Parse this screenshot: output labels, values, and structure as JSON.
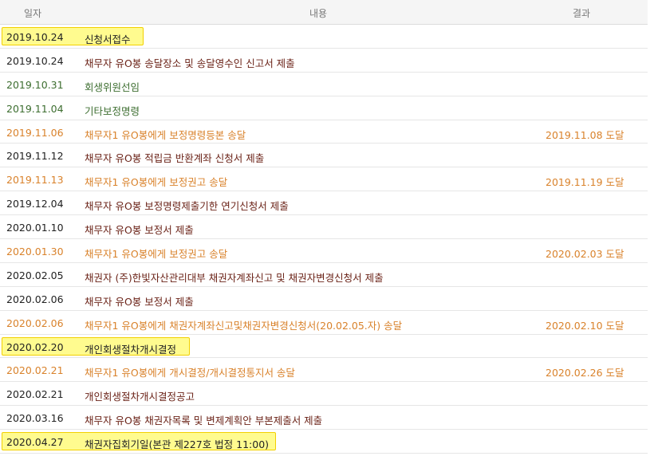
{
  "header": {
    "date": "일자",
    "content": "내용",
    "result": "결과"
  },
  "rows": [
    {
      "date": "2019.10.24",
      "content": "신청서접수",
      "result": "",
      "style": "highlight",
      "hl_width": 178
    },
    {
      "date": "2019.10.24",
      "content": "채무자 유O봉 송달장소 및 송달영수인 신고서 제출",
      "result": "",
      "style": "default"
    },
    {
      "date": "2019.10.31",
      "content": "회생위원선임",
      "result": "",
      "style": "green"
    },
    {
      "date": "2019.11.04",
      "content": "기타보정명령",
      "result": "",
      "style": "green"
    },
    {
      "date": "2019.11.06",
      "content": "채무자1 유O봉에게 보정명령등본 송달",
      "result": "2019.11.08 도달",
      "style": "orange"
    },
    {
      "date": "2019.11.12",
      "content": "채무자 유O봉 적립금 반환계좌 신청서 제출",
      "result": "",
      "style": "default"
    },
    {
      "date": "2019.11.13",
      "content": "채무자1 유O봉에게 보정권고 송달",
      "result": "2019.11.19 도달",
      "style": "orange"
    },
    {
      "date": "2019.12.04",
      "content": "채무자 유O봉 보정명령제출기한 연기신청서 제출",
      "result": "",
      "style": "default"
    },
    {
      "date": "2020.01.10",
      "content": "채무자 유O봉 보정서 제출",
      "result": "",
      "style": "default"
    },
    {
      "date": "2020.01.30",
      "content": "채무자1 유O봉에게 보정권고 송달",
      "result": "2020.02.03 도달",
      "style": "orange"
    },
    {
      "date": "2020.02.05",
      "content": "채권자 (주)한빛자산관리대부 채권자계좌신고 및 채권자변경신청서 제출",
      "result": "",
      "style": "default"
    },
    {
      "date": "2020.02.06",
      "content": "채무자 유O봉 보정서 제출",
      "result": "",
      "style": "default"
    },
    {
      "date": "2020.02.06",
      "content": "채무자1 유O봉에게 채권자계좌신고및채권자변경신청서(20.02.05.자) 송달",
      "result": "2020.02.10 도달",
      "style": "orange"
    },
    {
      "date": "2020.02.20",
      "content": "개인회생절차개시결정",
      "result": "",
      "style": "highlight",
      "hl_width": 236
    },
    {
      "date": "2020.02.21",
      "content": "채무자1 유O봉에게 개시결정/개시결정통지서 송달",
      "result": "2020.02.26 도달",
      "style": "orange"
    },
    {
      "date": "2020.02.21",
      "content": "개인회생절차개시결정공고",
      "result": "",
      "style": "default"
    },
    {
      "date": "2020.03.16",
      "content": "채무자 유O봉 채권자목록 및 변제계획안 부본제출서 제출",
      "result": "",
      "style": "default"
    },
    {
      "date": "2020.04.27",
      "content": "채권자집회기일(본관 제227호 법정 11:00)",
      "result": "",
      "style": "highlight",
      "hl_width": 344
    }
  ]
}
